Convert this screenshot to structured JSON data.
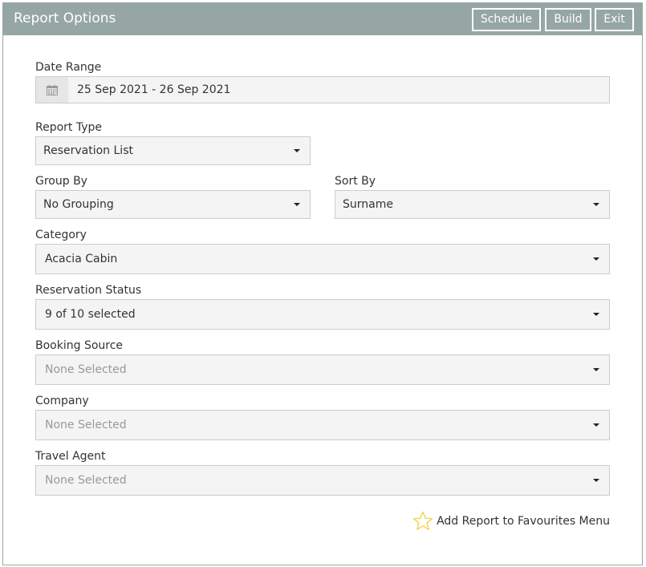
{
  "header": {
    "title": "Report Options",
    "buttons": {
      "schedule": "Schedule",
      "build": "Build",
      "exit": "Exit"
    }
  },
  "form": {
    "date_range": {
      "label": "Date Range",
      "value": "25 Sep 2021 - 26 Sep 2021",
      "icon": "calendar-icon"
    },
    "report_type": {
      "label": "Report Type",
      "value": "Reservation List"
    },
    "group_by": {
      "label": "Group By",
      "value": "No Grouping"
    },
    "sort_by": {
      "label": "Sort By",
      "value": "Surname"
    },
    "category": {
      "label": "Category",
      "value": "Acacia Cabin"
    },
    "reservation_status": {
      "label": "Reservation Status",
      "value": "9 of 10 selected"
    },
    "booking_source": {
      "label": "Booking Source",
      "value": "None Selected"
    },
    "company": {
      "label": "Company",
      "value": "None Selected"
    },
    "travel_agent": {
      "label": "Travel Agent",
      "value": "None Selected"
    }
  },
  "favourites": {
    "label": "Add Report to Favourites Menu",
    "icon": "star-icon"
  },
  "colors": {
    "header_bg": "#96a6a3",
    "field_bg": "#f4f4f4",
    "star": "#f0d44a"
  }
}
